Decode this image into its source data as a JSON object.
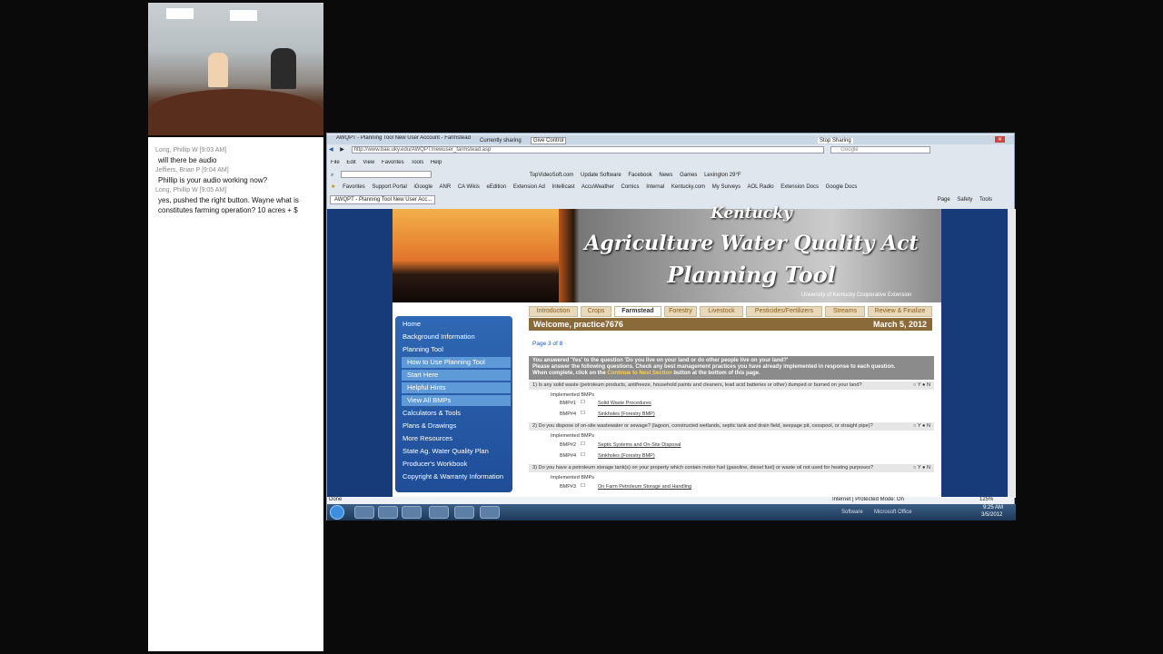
{
  "chat": {
    "messages": [
      {
        "meta": "Long, Phillip W [9:03 AM]",
        "text": "will there be audio"
      },
      {
        "meta": "Jeffiers, Brian P [9:04 AM]",
        "text": "Phillip is your audio working now?"
      },
      {
        "meta": "Long, Phillip W [9:05 AM]",
        "text": "yes, pushed the right button. Wayne what is constitutes farming operation? 10 acres + $"
      }
    ]
  },
  "browser": {
    "title": "AWQPT - Planning Tool New User Account - Farmstead",
    "sharing": "Currently sharing",
    "give_control": "Give Control",
    "stop_sharing": "Stop Sharing",
    "url": "http://www.bae.uky.edu/AWQPT/newuser_farmstead.asp",
    "search_placeholder": "Google",
    "menu": [
      "File",
      "Edit",
      "View",
      "Favorites",
      "Tools",
      "Help"
    ],
    "toolbar_items": [
      "TopVideoSoft.com",
      "Update Software",
      "Facebook",
      "News",
      "Games",
      "Lexington 29°F"
    ],
    "favorites": [
      "Favorites",
      "Support Portal",
      "iGoogle",
      "ANR",
      "CA Wikis",
      "eEdition",
      "Extension Ad",
      "Intellicast",
      "AccuWeather",
      "Comics",
      "Internal",
      "Kentucky.com",
      "My Surveys",
      "AOL Radio",
      "Extension Docs",
      "Google Docs"
    ],
    "tab_label": "AWQPT - Planning Tool New User Acc...",
    "page_tools": [
      "Page",
      "Safety",
      "Tools"
    ],
    "status_left": "Done",
    "status_right": "Internet | Protected Mode: On",
    "zoom": "125%"
  },
  "site": {
    "banner": {
      "line1": "Kentucky",
      "line2": "Agriculture Water Quality Act",
      "line3": "Planning Tool",
      "credit": "University of Kentucky Cooperative Extension"
    },
    "tabs": [
      "Introduction",
      "Crops",
      "Farmstead",
      "Forestry",
      "Livestock",
      "Pesticides/Fertilizers",
      "Streams",
      "Review & Finalize"
    ],
    "welcome": "Welcome, practice7676",
    "date": "March 5, 2012",
    "menu": {
      "items": [
        "Home",
        "Background Information",
        "Planning Tool"
      ],
      "sub": [
        "How to Use Planning Tool",
        "Start Here",
        "Helpful Hints",
        "View All BMPs"
      ],
      "items2": [
        "Calculators & Tools",
        "Plans & Drawings",
        "More Resources",
        "State Ag. Water Quality Plan",
        "Producer's Workbook",
        "Copyright & Warranty Information"
      ]
    },
    "page_of": "Page 3 of 8",
    "instructions": {
      "line1": "You answered 'Yes' to the question 'Do you live on your land or do other people live on your land?'",
      "line2": "Please answer the following questions. Check any best management practices you have already implemented in response to each question.",
      "line3a": "When complete, click on the ",
      "line3link": "Continue to Next Section",
      "line3b": " button at the bottom of this page."
    },
    "questions": [
      {
        "text": "1) Is any solid waste (petroleum products, antifreeze, household paints and cleaners, lead acid batteries or other) dumped or burned on your land?",
        "bmps": [
          [
            "BMP#1",
            "Solid Waste Procedures"
          ],
          [
            "BMP#4",
            "Sinkholes (Forestry BMP)"
          ]
        ]
      },
      {
        "text": "2) Do you dispose of on-site wastewater or sewage? (lagoon, constructed wetlands, septic tank and drain field, seepage pit, cesspool, or straight pipe)?",
        "bmps": [
          [
            "BMP#2",
            "Septic Systems and On-Site Disposal"
          ],
          [
            "BMP#4",
            "Sinkholes (Forestry BMP)"
          ]
        ]
      },
      {
        "text": "3) Do you have a petroleum storage tank(s) on your property which contain motor fuel (gasoline, diesel fuel) or waste oil not used for heating purposes?",
        "bmps": [
          [
            "BMP#3",
            "On Farm Petroleum Storage and Handling"
          ]
        ]
      }
    ],
    "implemented_label": "Implemented BMPs",
    "yes": "Y",
    "no": "N"
  },
  "taskbar": {
    "software": "Software",
    "office": "Microsoft Office",
    "time": "9:25 AM",
    "date": "3/5/2012"
  }
}
